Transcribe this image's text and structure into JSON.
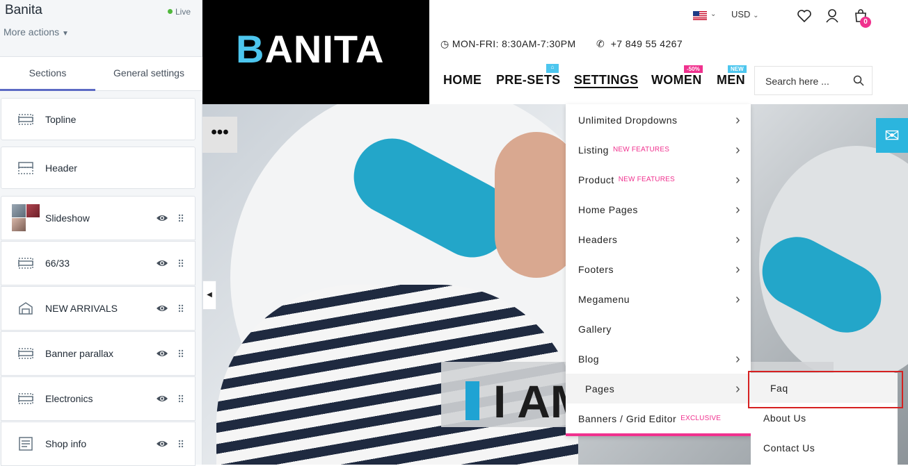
{
  "editor": {
    "shop_name": "Banita",
    "status": "Live",
    "more_actions": "More actions",
    "tabs": [
      "Sections",
      "General settings"
    ],
    "sections": [
      {
        "label": "Topline",
        "icon": "layout-bar-icon"
      },
      {
        "label": "Header",
        "icon": "layout-header-icon"
      },
      {
        "label": "Slideshow",
        "icon": "slideshow-thumbnail"
      },
      {
        "label": "66/33",
        "icon": "layout-bar-icon"
      },
      {
        "label": "NEW ARRIVALS",
        "icon": "product-tag-icon"
      },
      {
        "label": "Banner parallax",
        "icon": "layout-bar-icon"
      },
      {
        "label": "Electronics",
        "icon": "layout-bar-icon"
      },
      {
        "label": "Shop info",
        "icon": "text-block-icon"
      }
    ]
  },
  "store": {
    "logo_first": "B",
    "logo_rest": "ANITA",
    "currency": "USD",
    "cart_count": "0",
    "hours": "MON-FRI: 8:30AM-7:30PM",
    "phone": "+7 849 55 4267",
    "nav": [
      {
        "label": "HOME",
        "badge": ""
      },
      {
        "label": "PRE-SETS",
        "badge": ""
      },
      {
        "label": "SETTINGS",
        "badge": ""
      },
      {
        "label": "WOMEN",
        "badge": "-50%"
      },
      {
        "label": "MEN",
        "badge": "NEW"
      }
    ],
    "search_placeholder": "Search here ...",
    "hero_text": "I AM",
    "dropdown": [
      {
        "label": "Unlimited Dropdowns",
        "tag": "",
        "arrow": true
      },
      {
        "label": "Listing",
        "tag": "NEW FEATURES",
        "arrow": true
      },
      {
        "label": "Product",
        "tag": "NEW FEATURES",
        "arrow": true
      },
      {
        "label": "Home Pages",
        "tag": "",
        "arrow": true
      },
      {
        "label": "Headers",
        "tag": "",
        "arrow": true
      },
      {
        "label": "Footers",
        "tag": "",
        "arrow": true
      },
      {
        "label": "Megamenu",
        "tag": "",
        "arrow": true
      },
      {
        "label": "Gallery",
        "tag": "",
        "arrow": false
      },
      {
        "label": "Blog",
        "tag": "",
        "arrow": true
      },
      {
        "label": "Pages",
        "tag": "",
        "arrow": true
      },
      {
        "label": "Banners / Grid Editor",
        "tag": "EXCLUSIVE",
        "arrow": false
      }
    ],
    "submenu": [
      "Faq",
      "About Us",
      "Contact Us"
    ]
  },
  "colors": {
    "accent": "#5c6ac4",
    "brand_blue": "#4dc6ee",
    "pink": "#f0318e",
    "highlight": "#d62020"
  }
}
